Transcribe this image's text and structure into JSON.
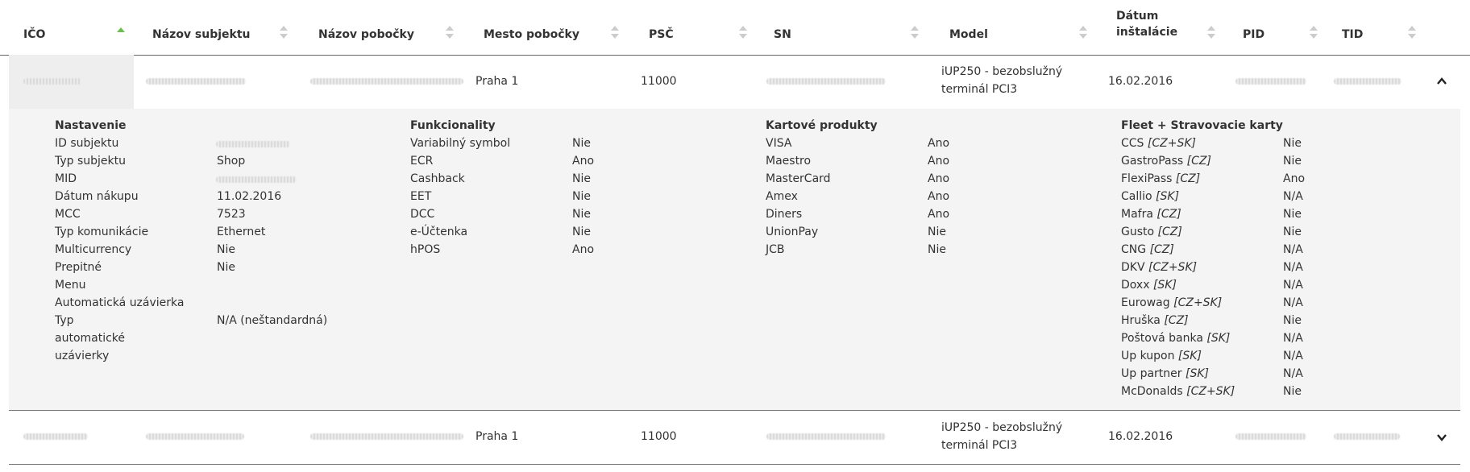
{
  "columns": [
    {
      "label": "IČO",
      "sorted": "asc"
    },
    {
      "label": "Názov subjektu"
    },
    {
      "label": "Názov pobočky"
    },
    {
      "label": "Mesto pobočky"
    },
    {
      "label": "PSČ"
    },
    {
      "label": "SN"
    },
    {
      "label": "Model"
    },
    {
      "label": "Dátum inštalácie"
    },
    {
      "label": "PID"
    },
    {
      "label": "TID"
    }
  ],
  "rows": [
    {
      "mesto": "Praha 1",
      "psc": "11000",
      "model_line1": "iUP250 - bezobslužný",
      "model_line2": "terminál PCI3",
      "datum": "16.02.2016",
      "expanded": true
    },
    {
      "mesto": "Praha 1",
      "psc": "11000",
      "model_line1": "iUP250 - bezobslužný",
      "model_line2": "terminál PCI3",
      "datum": "16.02.2016",
      "expanded": false
    }
  ],
  "detail": {
    "nastavenie": {
      "title": "Nastavenie",
      "items": [
        {
          "k": "ID subjektu",
          "v": ""
        },
        {
          "k": "Typ subjektu",
          "v": "Shop"
        },
        {
          "k": "MID",
          "v": ""
        },
        {
          "k": "Dátum nákupu",
          "v": "11.02.2016"
        },
        {
          "k": "MCC",
          "v": "7523"
        },
        {
          "k": "Typ komunikácie",
          "v": "Ethernet"
        },
        {
          "k": "Multicurrency",
          "v": "Nie"
        },
        {
          "k": "Prepitné",
          "v": "Nie"
        },
        {
          "k": "Menu",
          "v": ""
        },
        {
          "k": "Automatická uzávierka",
          "v": ""
        },
        {
          "k": "Typ automatické uzávierky",
          "v": "N/A (neštandardná)"
        }
      ]
    },
    "funkcionality": {
      "title": "Funkcionality",
      "items": [
        {
          "k": "Variabilný symbol",
          "v": "Nie"
        },
        {
          "k": "ECR",
          "v": "Ano"
        },
        {
          "k": "Cashback",
          "v": "Nie"
        },
        {
          "k": "EET",
          "v": "Nie"
        },
        {
          "k": "DCC",
          "v": "Nie"
        },
        {
          "k": "e-Účtenka",
          "v": "Nie"
        },
        {
          "k": "hPOS",
          "v": "Ano"
        }
      ]
    },
    "kartove": {
      "title": "Kartové produkty",
      "items": [
        {
          "k": "VISA",
          "v": "Ano"
        },
        {
          "k": "Maestro",
          "v": "Ano"
        },
        {
          "k": "MasterCard",
          "v": "Ano"
        },
        {
          "k": "Amex",
          "v": "Ano"
        },
        {
          "k": "Diners",
          "v": "Ano"
        },
        {
          "k": "UnionPay",
          "v": "Nie"
        },
        {
          "k": "JCB",
          "v": "Nie"
        }
      ]
    },
    "fleet": {
      "title": "Fleet + Stravovacie karty",
      "items": [
        {
          "k": "CCS",
          "tag": "[CZ+SK]",
          "v": "Nie"
        },
        {
          "k": "GastroPass",
          "tag": "[CZ]",
          "v": "Nie"
        },
        {
          "k": "FlexiPass",
          "tag": "[CZ]",
          "v": "Ano"
        },
        {
          "k": "Callio",
          "tag": "[SK]",
          "v": "N/A"
        },
        {
          "k": "Mafra",
          "tag": "[CZ]",
          "v": "Nie"
        },
        {
          "k": "Gusto",
          "tag": "[CZ]",
          "v": "Nie"
        },
        {
          "k": "CNG",
          "tag": "[CZ]",
          "v": "N/A"
        },
        {
          "k": "DKV",
          "tag": "[CZ+SK]",
          "v": "N/A"
        },
        {
          "k": "Doxx",
          "tag": "[SK]",
          "v": "N/A"
        },
        {
          "k": "Eurowag",
          "tag": "[CZ+SK]",
          "v": "N/A"
        },
        {
          "k": "Hruška",
          "tag": "[CZ]",
          "v": "Nie"
        },
        {
          "k": "Poštová banka",
          "tag": "[SK]",
          "v": "N/A"
        },
        {
          "k": "Up kupon",
          "tag": "[SK]",
          "v": "N/A"
        },
        {
          "k": "Up partner",
          "tag": "[SK]",
          "v": "N/A"
        },
        {
          "k": "McDonalds",
          "tag": "[CZ+SK]",
          "v": "Nie"
        }
      ]
    }
  },
  "colors": {
    "sort_active": "#6cc04a",
    "sort_inactive": "#cccccc",
    "header_border": "#666666",
    "detail_bg": "#f4f4f4"
  },
  "icons": {
    "expanded": "chevron-up-icon",
    "collapsed": "chevron-down-icon"
  }
}
